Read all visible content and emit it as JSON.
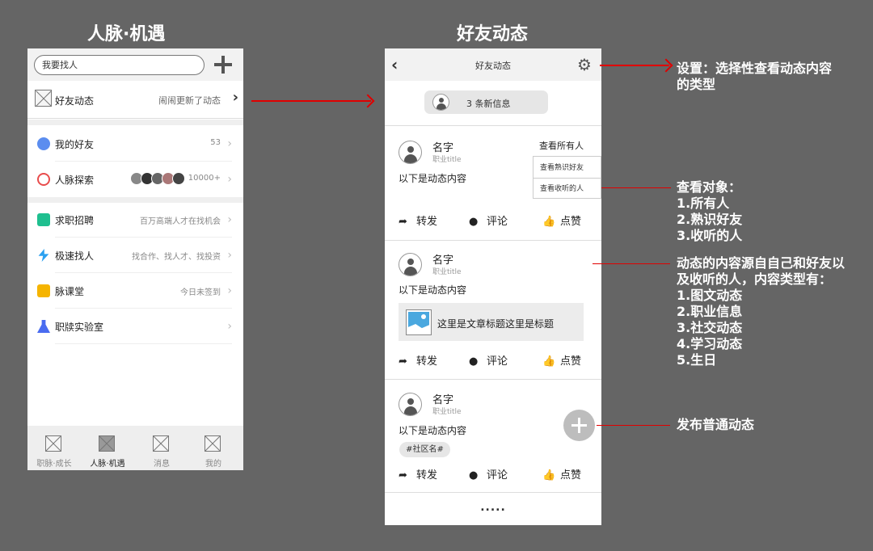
{
  "titles": {
    "left": "人脉·机遇",
    "right": "好友动态"
  },
  "left_screen": {
    "search_placeholder": "我要找人",
    "friend_feed": {
      "label": "好友动态",
      "update_text": "闹闹更新了动态"
    },
    "items": [
      {
        "label": "我的好友",
        "right": "53",
        "icon": "friends-icon",
        "color": "#5b8def"
      },
      {
        "label": "人脉探索",
        "right": "10000+",
        "icon": "network-icon",
        "color": "#e84c4c"
      },
      {
        "label": "求职招聘",
        "right": "百万高端人才在找机会",
        "icon": "briefcase-icon",
        "color": "#1fbf8f"
      },
      {
        "label": "极速找人",
        "right": "找合作、找人才、找投资",
        "icon": "lightning-icon",
        "color": "#2aa0f0"
      },
      {
        "label": "脉课堂",
        "right": "今日未签到",
        "icon": "video-icon",
        "color": "#f5b400"
      },
      {
        "label": "职牍实验室",
        "right": "",
        "icon": "flask-icon",
        "color": "#4a6cf0"
      }
    ],
    "tabs": [
      {
        "label": "职脉·成长",
        "active": false
      },
      {
        "label": "人脉·机遇",
        "active": true
      },
      {
        "label": "消息",
        "active": false
      },
      {
        "label": "我的",
        "active": false
      }
    ]
  },
  "right_screen": {
    "header_title": "好友动态",
    "new_messages": "3 条新信息",
    "filter_label": "查看所有人",
    "filter_options": [
      "查看熟识好友",
      "查看收听的人"
    ],
    "posts": [
      {
        "name": "名字",
        "job": "职业title",
        "content": "以下是动态内容"
      },
      {
        "name": "名字",
        "job": "职业title",
        "content": "以下是动态内容",
        "article_title": "这里是文章标题这里是标题"
      },
      {
        "name": "名字",
        "job": "职业title",
        "content": "以下是动态内容",
        "tag": "#社区名#"
      }
    ],
    "actions": {
      "forward": "转发",
      "comment": "评论",
      "like": "点赞"
    },
    "more": "....."
  },
  "annotations": {
    "settings": [
      "设置：选择性查看动态内容",
      "的类型"
    ],
    "view_target": [
      "查看对象：",
      "1.所有人",
      "2.熟识好友",
      "3.收听的人"
    ],
    "content_source": [
      "动态的内容源自自己和好友以",
      "及收听的人，内容类型有：",
      "1.图文动态",
      "2.职业信息",
      "3.社交动态",
      "4.学习动态",
      "5.生日"
    ],
    "publish": [
      "发布普通动态"
    ]
  },
  "colors": {
    "background": "#656565",
    "annotation_arrow": "#e00000"
  }
}
